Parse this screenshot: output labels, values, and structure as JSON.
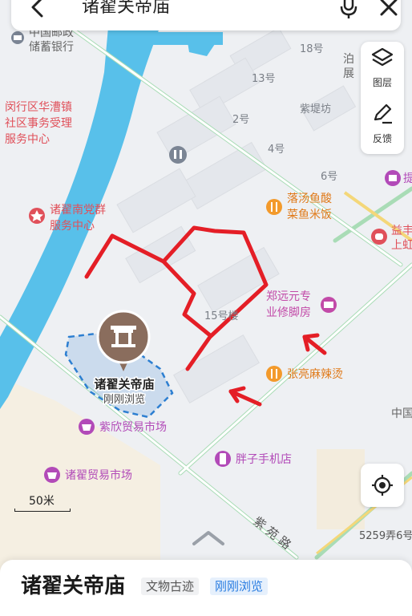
{
  "search": {
    "query": "诸翟关帝庙"
  },
  "tools": {
    "layers_label": "图层",
    "feedback_label": "反馈"
  },
  "scale": {
    "label": "50米"
  },
  "place_card": {
    "name": "诸翟关帝庙",
    "category": "文物古迹",
    "badge": "刚刚浏览"
  },
  "selected_marker": {
    "name": "诸翟关帝庙",
    "tag": "刚刚浏览"
  },
  "colors": {
    "water": "#58c0ea",
    "road_green": "#a9dcb6",
    "route": "#e41e26",
    "selection": "#2d7fd1",
    "pin": "#8a6d5d"
  },
  "pois": [
    {
      "id": "bank",
      "lines": [
        "中国邮政",
        "储蓄银行"
      ],
      "color": "#666666",
      "icon": "bank-icon"
    },
    {
      "id": "gov",
      "lines": [
        "闵行区华漕镇",
        "社区事务受理",
        "服务中心"
      ],
      "color": "#e0505a",
      "icon": ""
    },
    {
      "id": "party",
      "lines": [
        "诸翟南党群",
        "服务中心"
      ],
      "color": "#e0505a",
      "icon": "star-icon"
    },
    {
      "id": "toilet",
      "lines": [],
      "color": "#666666",
      "icon": "restroom-icon"
    },
    {
      "id": "fish",
      "lines": [
        "落汤鱼酸",
        "菜鱼米饭"
      ],
      "color": "#e07a1a",
      "icon": "restaurant-icon"
    },
    {
      "id": "shoe",
      "lines": [
        "郑远元专",
        "业修脚房"
      ],
      "color": "#c24aa8",
      "icon": "service-icon"
    },
    {
      "id": "malatang",
      "lines": [
        "张亮麻辣烫"
      ],
      "color": "#e07a1a",
      "icon": "restaurant-icon"
    },
    {
      "id": "zixin",
      "lines": [
        "紫欣贸易市场"
      ],
      "color": "#b24ab8",
      "icon": "market-icon"
    },
    {
      "id": "zhudi",
      "lines": [
        "诸翟贸易市场"
      ],
      "color": "#b24ab8",
      "icon": "market-icon"
    },
    {
      "id": "phone",
      "lines": [
        "胖子手机店"
      ],
      "color": "#b24ab8",
      "icon": "phone-icon"
    },
    {
      "id": "bo",
      "lines": [
        "泊",
        "展"
      ],
      "color": "#666666",
      "icon": ""
    },
    {
      "id": "yifeng",
      "lines": [
        "益丰",
        "上虹"
      ],
      "color": "#e0505a",
      "icon": "pharmacy-icon"
    },
    {
      "id": "zhongguo",
      "lines": [
        "中国"
      ],
      "color": "#666666",
      "icon": ""
    },
    {
      "id": "ti",
      "lines": [
        "提"
      ],
      "color": "#b24ab8",
      "icon": "shop-icon"
    }
  ],
  "labels": [
    {
      "id": "b18",
      "text": "18号"
    },
    {
      "id": "b13",
      "text": "13号"
    },
    {
      "id": "b2",
      "text": "2号"
    },
    {
      "id": "b4",
      "text": "4号"
    },
    {
      "id": "b6",
      "text": "6号"
    },
    {
      "id": "b15",
      "text": "15号楼"
    },
    {
      "id": "zidifang",
      "text": "紫堤坊"
    },
    {
      "id": "ziyuanlu",
      "text": "紫 苑 路"
    },
    {
      "id": "lane5259",
      "text": "5259弄6号"
    }
  ]
}
